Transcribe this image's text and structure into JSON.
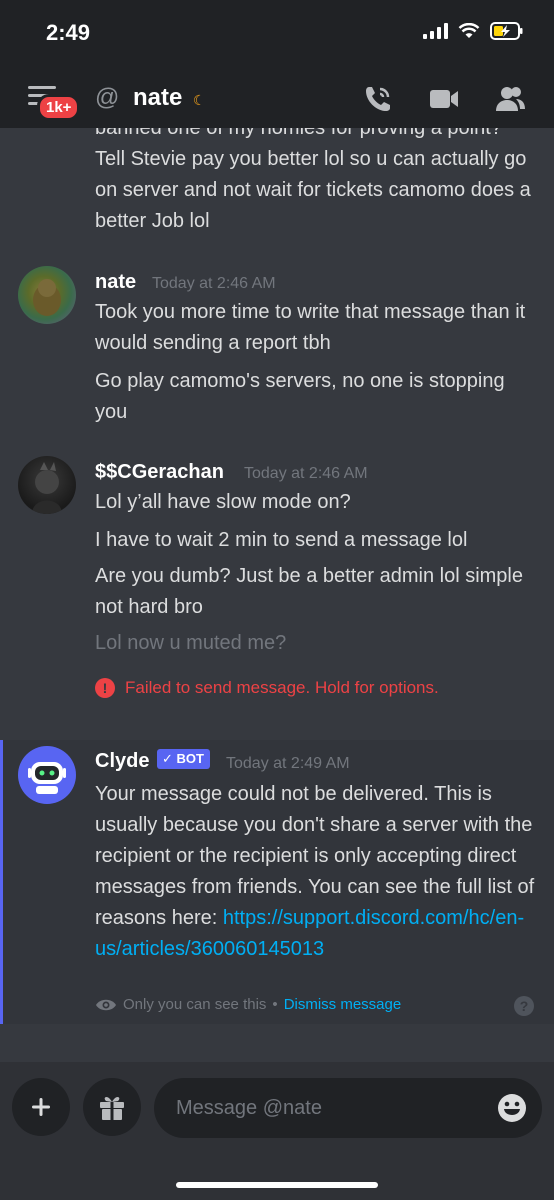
{
  "status_bar": {
    "time": "2:49"
  },
  "header": {
    "badge": "1k+",
    "name": "nate"
  },
  "messages": {
    "partial_text": "banned one of my homies for proving a point? Tell Stevie pay you better lol so u can actually go on server and not wait for tickets camomo does a better Job lol",
    "nate": {
      "username": "nate",
      "timestamp": "Today at 2:46 AM",
      "lines": [
        "Took you more time to write that message than it would sending a report tbh",
        "Go play camomo's servers, no one is stopping you"
      ]
    },
    "gerachan": {
      "username": "$$CGerachan",
      "timestamp": "Today at 2:46 AM",
      "lines": [
        "Lol y’all have slow mode on?",
        "I have to wait 2 min to send a message lol",
        "Are you dumb? Just be a better admin lol simple not hard bro"
      ],
      "pending": "Lol now u muted me?",
      "failed": "Failed to send message. Hold for options."
    },
    "clyde": {
      "username": "Clyde",
      "bot_badge": "BOT",
      "timestamp": "Today at 2:49 AM",
      "text": "Your message could not be delivered. This is usually because you don't share a server with the recipient or the recipient is only accepting direct messages from friends. You can see the full list of reasons here: ",
      "link": "https://support.discord.com/hc/en-us/articles/360060145013",
      "only_you": "Only you can see this",
      "separator": "•",
      "dismiss": "Dismiss message"
    }
  },
  "composer": {
    "placeholder": "Message @nate"
  },
  "colors": {
    "background": "#36393f",
    "header": "#202225",
    "blurple": "#5865f2",
    "danger": "#ed4245",
    "link": "#00aff4"
  },
  "icons": [
    "hamburger-icon",
    "at-icon",
    "moon-icon",
    "phone-call-icon",
    "video-icon",
    "members-icon",
    "error-icon",
    "eye-icon",
    "help-icon",
    "plus-icon",
    "gift-icon",
    "emoji-icon"
  ]
}
